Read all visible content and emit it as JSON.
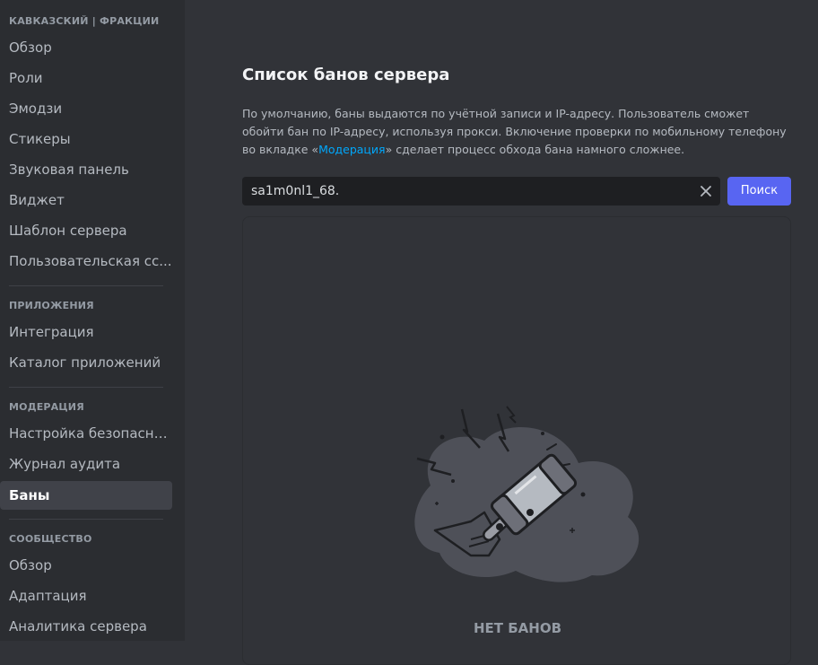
{
  "sidebar": {
    "server_section": "КАВКАЗСКИЙ | ФРАКЦИИ",
    "server_items": [
      {
        "label": "Обзор"
      },
      {
        "label": "Роли"
      },
      {
        "label": "Эмодзи"
      },
      {
        "label": "Стикеры"
      },
      {
        "label": "Звуковая панель"
      },
      {
        "label": "Виджет"
      },
      {
        "label": "Шаблон сервера"
      },
      {
        "label": "Пользовательская сс..."
      }
    ],
    "apps_section": "ПРИЛОЖЕНИЯ",
    "apps_items": [
      {
        "label": "Интеграция"
      },
      {
        "label": "Каталог приложений"
      }
    ],
    "moderation_section": "МОДЕРАЦИЯ",
    "moderation_items": [
      {
        "label": "Настройка безопасно..."
      },
      {
        "label": "Журнал аудита"
      },
      {
        "label": "Баны",
        "active": true
      }
    ],
    "community_section": "СООБЩЕСТВО",
    "community_items": [
      {
        "label": "Обзор"
      },
      {
        "label": "Адаптация"
      },
      {
        "label": "Аналитика сервера"
      }
    ]
  },
  "main": {
    "title": "Список банов сервера",
    "desc_part1": "По умолчанию, баны выдаются по учётной записи и IP-адресу. Пользователь сможет обойти бан по IP-адресу, используя прокси. Включение проверки по мобильному телефону во вкладке «",
    "desc_link": "Модерация",
    "desc_part2": "» сделает процесс обхода бана намного сложнее.",
    "search_value": "sa1m0nl1_68.",
    "search_button": "Поиск",
    "empty_text": "НЕТ БАНОВ"
  },
  "colors": {
    "accent": "#5865f2",
    "link": "#00a8fc",
    "sidebar_bg": "#2b2d31",
    "main_bg": "#313338"
  },
  "icons": {
    "clear": "close-icon",
    "illustration": "ban-hammer-illustration"
  }
}
